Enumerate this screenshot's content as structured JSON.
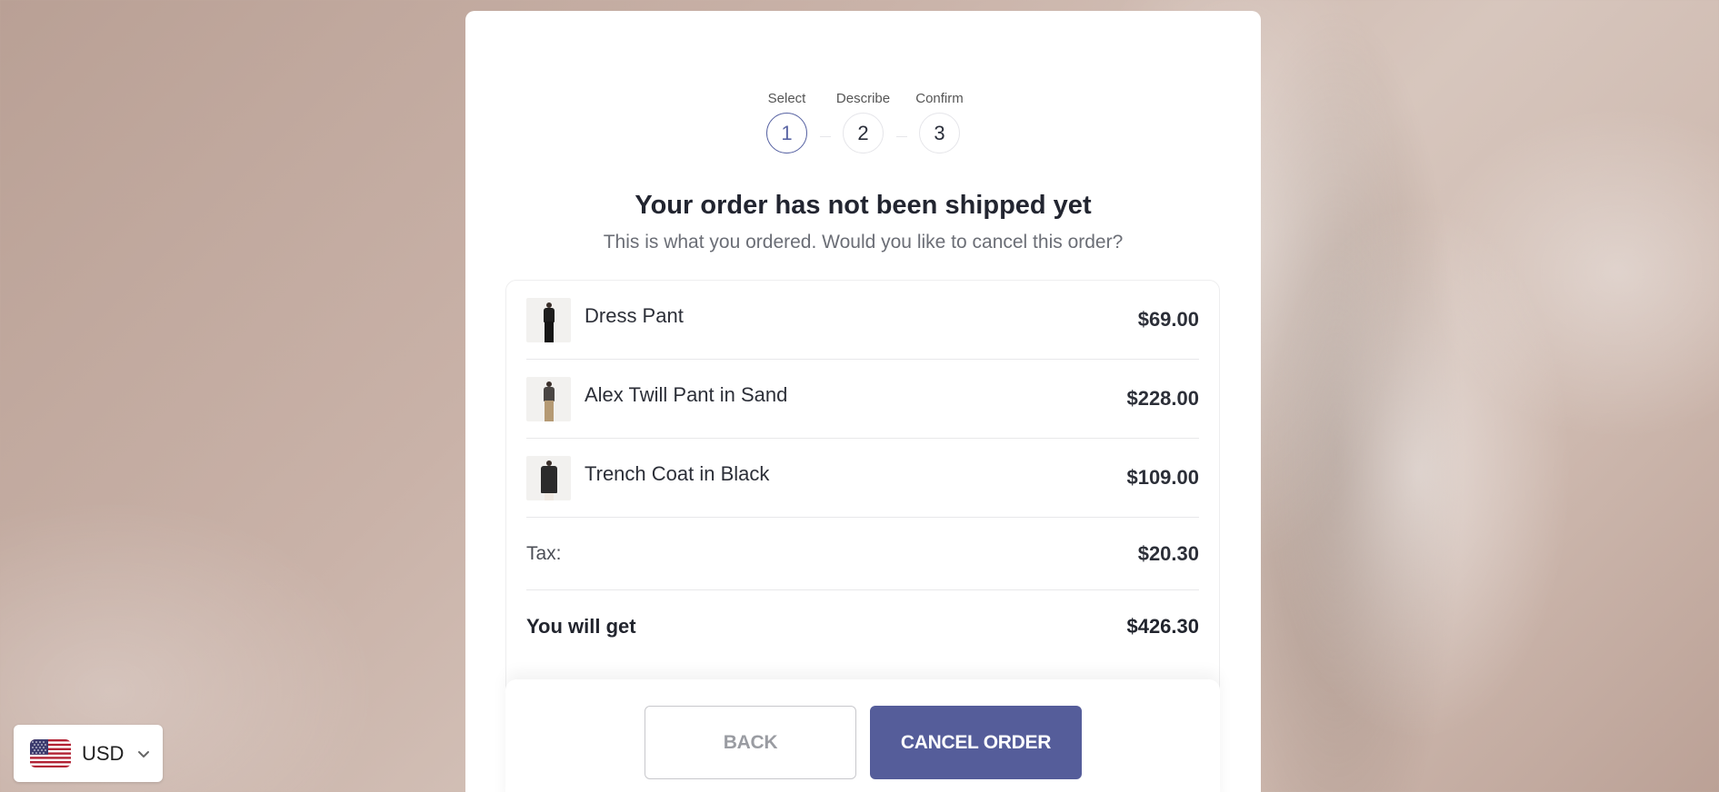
{
  "stepper": {
    "steps": [
      {
        "label": "Select",
        "number": "1",
        "active": true
      },
      {
        "label": "Describe",
        "number": "2",
        "active": false
      },
      {
        "label": "Confirm",
        "number": "3",
        "active": false
      }
    ],
    "accent_color": "#5a65a4"
  },
  "header": {
    "title": "Your order has not been shipped yet",
    "subtitle": "This is what you ordered. Would you like to cancel this order?"
  },
  "order": {
    "items": [
      {
        "name": "Dress Pant",
        "price": "$69.00",
        "thumb_icon": "person-black-outfit-icon"
      },
      {
        "name": "Alex Twill Pant in Sand",
        "price": "$228.00",
        "thumb_icon": "person-sand-pant-icon"
      },
      {
        "name": "Trench Coat in Black",
        "price": "$109.00",
        "thumb_icon": "person-black-coat-icon"
      }
    ],
    "tax_label": "Tax:",
    "tax_value": "$20.30",
    "total_label": "You will get",
    "total_value": "$426.30"
  },
  "actions": {
    "back_label": "BACK",
    "cancel_label": "CANCEL ORDER",
    "cancel_color": "#555d9a"
  },
  "currency": {
    "flag_icon": "us-flag-icon",
    "code": "USD",
    "chevron_icon": "chevron-down-icon"
  }
}
